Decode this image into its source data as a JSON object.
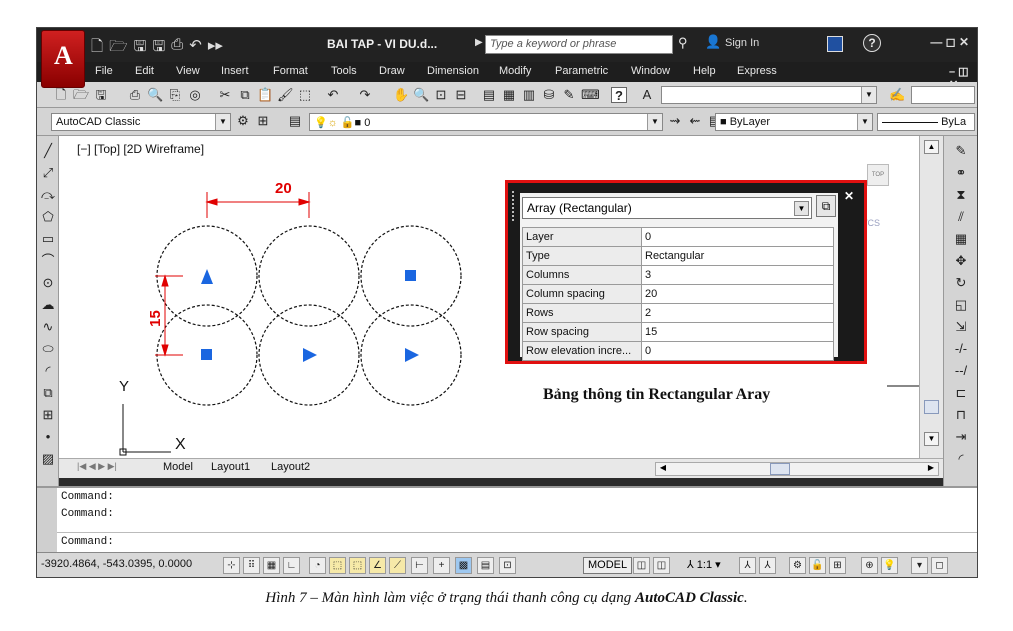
{
  "window": {
    "title": "BAI TAP - VI DU.d...",
    "search_placeholder": "Type a keyword or phrase",
    "signin": "Sign In",
    "controls": "— ◻ ✕",
    "help": "?"
  },
  "menu": [
    "File",
    "Edit",
    "View",
    "Insert",
    "Format",
    "Tools",
    "Draw",
    "Dimension",
    "Modify",
    "Parametric",
    "Window",
    "Help",
    "Express"
  ],
  "toolbar2": {
    "workspace": "AutoCAD Classic",
    "layer_value": "0",
    "color_value": "ByLayer",
    "linetype_value": "ByLa"
  },
  "drawing": {
    "view_label": "[−] [Top] [2D Wireframe]",
    "dim_horizontal": "20",
    "dim_vertical": "15",
    "ucs_y": "Y",
    "ucs_x": "X",
    "viewcube_top": "TOP",
    "wcs_label": "WCS"
  },
  "properties": {
    "object_type": "Array (Rectangular)",
    "rows": [
      {
        "key": "Layer",
        "value": "0"
      },
      {
        "key": "Type",
        "value": "Rectangular"
      },
      {
        "key": "Columns",
        "value": "3"
      },
      {
        "key": "Column spacing",
        "value": "20"
      },
      {
        "key": "Rows",
        "value": "2"
      },
      {
        "key": "Row spacing",
        "value": "15"
      },
      {
        "key": "Row elevation incre...",
        "value": "0"
      }
    ]
  },
  "annotation": "Bảng thông tin Rectangular Aray",
  "tabs": [
    "Model",
    "Layout1",
    "Layout2"
  ],
  "command_lines": [
    "Command:",
    "Command:",
    "Command:"
  ],
  "status": {
    "coordinates": "-3920.4864, -543.0395, 0.0000",
    "model": "MODEL",
    "scale": "1:1"
  },
  "caption": {
    "prefix": "Hình 7 – Màn hình làm việc ở trạng thái thanh công cụ dạng ",
    "bold": "AutoCAD Classic",
    "suffix": "."
  },
  "colors": {
    "highlight_border": "#e01010",
    "dimension": "#e00000",
    "glyph_blue": "#1a66e0"
  }
}
